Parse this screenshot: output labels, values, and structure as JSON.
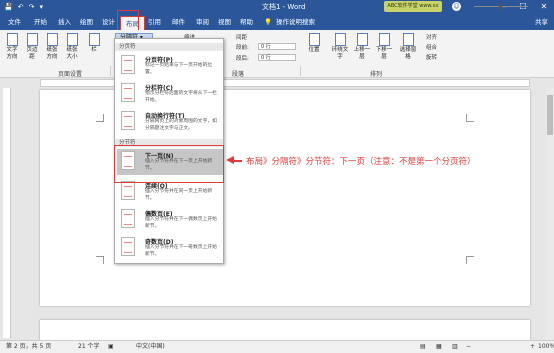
{
  "titlebar": {
    "doc_title": "文档1 - Word",
    "qat": [
      "💾",
      "↶",
      "↷",
      "▾"
    ],
    "watermark_text": "ABC软件学堂 www.xx",
    "window_controls": [
      "—",
      "☐",
      "✕"
    ]
  },
  "tabs": [
    "文件",
    "开始",
    "插入",
    "绘图",
    "设计",
    "布局",
    "引用",
    "邮件",
    "审阅",
    "视图",
    "帮助"
  ],
  "active_tab": "布局",
  "tell_me": "操作说明搜索",
  "share": "共享",
  "ribbon": {
    "buttons": [
      "文字方向",
      "页边距",
      "纸张方向",
      "纸张大小",
      "栏"
    ],
    "break_btn": "分隔符",
    "indent_label": "缩进",
    "spacing_label": "间距",
    "before_label": "段前:",
    "after_label": "段后:",
    "before_value": "0 行",
    "after_value": "0 行",
    "arrange_buttons": [
      "位置",
      "环绕文字",
      "上移一层",
      "下移一层",
      "选择窗格"
    ],
    "align": "对齐",
    "group": "组合",
    "rotate": "旋转",
    "group_labels": [
      "页面设置",
      "段落",
      "排列"
    ]
  },
  "dropdown": {
    "page_section": "分页符",
    "section_section": "分节符",
    "items": [
      {
        "title": "分页符(P)",
        "desc": "标记一页结束与下一页开始的位置。"
      },
      {
        "title": "分栏符(C)",
        "desc": "指示分栏符后面的文字将从下一栏开始。"
      },
      {
        "title": "自动换行符(T)",
        "desc": "分隔网页上的对象周围的文字，如分隔题注文字与正文。"
      },
      {
        "title": "下一页(N)",
        "desc": "插入分节符并在下一页上开始新节。"
      },
      {
        "title": "连续(O)",
        "desc": "插入分节符并在同一页上开始新节。"
      },
      {
        "title": "偶数页(E)",
        "desc": "插入分节符并在下一偶数页上开始新节。"
      },
      {
        "title": "奇数页(D)",
        "desc": "插入分节符并在下一奇数页上开始新节。"
      }
    ]
  },
  "annotation": "布局》分隔符》分节符：下一页（注意：不是第一个分页符）",
  "status": {
    "page": "第 2 页，共 5 页",
    "words": "21 个字",
    "lang": "中文(中国)",
    "zoom": "100%"
  }
}
